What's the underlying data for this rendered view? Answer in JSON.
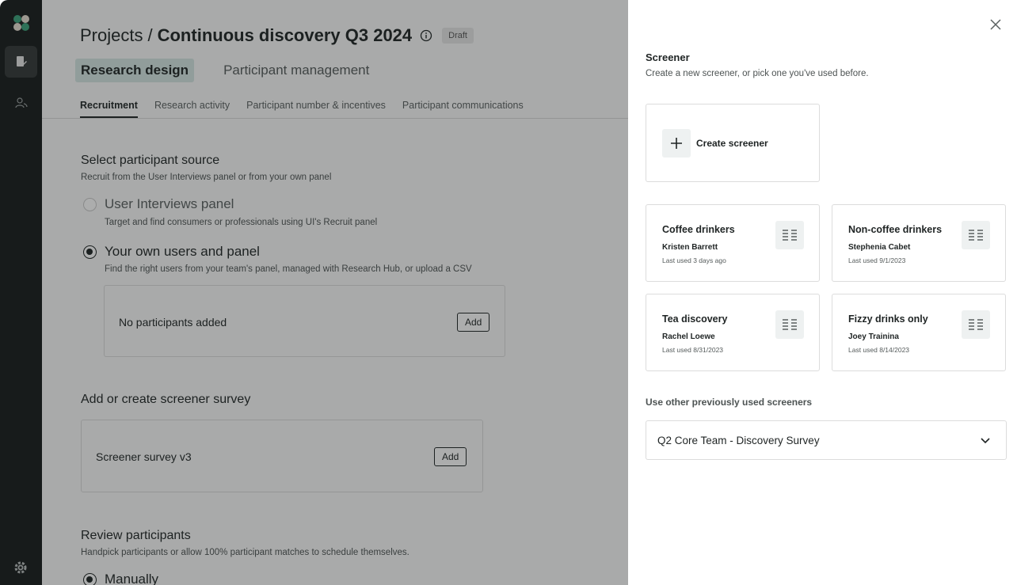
{
  "colors": {
    "rail": "#171c1c",
    "accent_tab": "#d5e6e3",
    "logo_green": "#3aa27a",
    "logo_light": "#e7ded2"
  },
  "rail": {
    "icons": [
      "logo-icon",
      "document-edit-icon",
      "users-icon",
      "gear-icon"
    ]
  },
  "header": {
    "crumb": "Projects",
    "separator": "/",
    "project_name": "Continuous discovery Q3 2024",
    "status_badge": "Draft"
  },
  "primary_tabs": [
    {
      "label": "Research design",
      "active": true
    },
    {
      "label": "Participant management",
      "active": false
    }
  ],
  "secondary_tabs": [
    {
      "label": "Recruitment",
      "active": true
    },
    {
      "label": "Research activity",
      "active": false
    },
    {
      "label": "Participant number & incentives",
      "active": false
    },
    {
      "label": "Participant communications",
      "active": false
    }
  ],
  "participant_source": {
    "title": "Select participant source",
    "subtitle": "Recruit from the User Interviews panel or from your own panel",
    "options": [
      {
        "label": "User Interviews panel",
        "description": "Target and find consumers or professionals using UI's Recruit panel",
        "selected": false
      },
      {
        "label": "Your own users and panel",
        "description": "Find the right users from your team's panel, managed with Research Hub, or upload a CSV",
        "selected": true
      }
    ],
    "empty_text": "No participants added",
    "add_label": "Add"
  },
  "screener_survey": {
    "title": "Add or create screener survey",
    "item": "Screener survey v3",
    "add_label": "Add"
  },
  "review": {
    "title": "Review participants",
    "subtitle": "Handpick participants or allow 100% participant matches to schedule themselves.",
    "option": "Manually"
  },
  "drawer": {
    "title": "Screener",
    "subtitle": "Create a new screener, or pick one you've used before.",
    "create_label": "Create screener",
    "screeners": [
      {
        "name": "Coffee drinkers",
        "owner": "Kristen Barrett",
        "last_used": "Last used 3 days ago"
      },
      {
        "name": "Non-coffee drinkers",
        "owner": "Stephenia Cabet",
        "last_used": "Last used 9/1/2023"
      },
      {
        "name": "Tea discovery",
        "owner": "Rachel Loewe",
        "last_used": "Last used 8/31/2023"
      },
      {
        "name": "Fizzy drinks only",
        "owner": "Joey Trainina",
        "last_used": "Last used 8/14/2023"
      }
    ],
    "other_label": "Use other previously used screeners",
    "select_value": "Q2 Core Team - Discovery Survey"
  }
}
